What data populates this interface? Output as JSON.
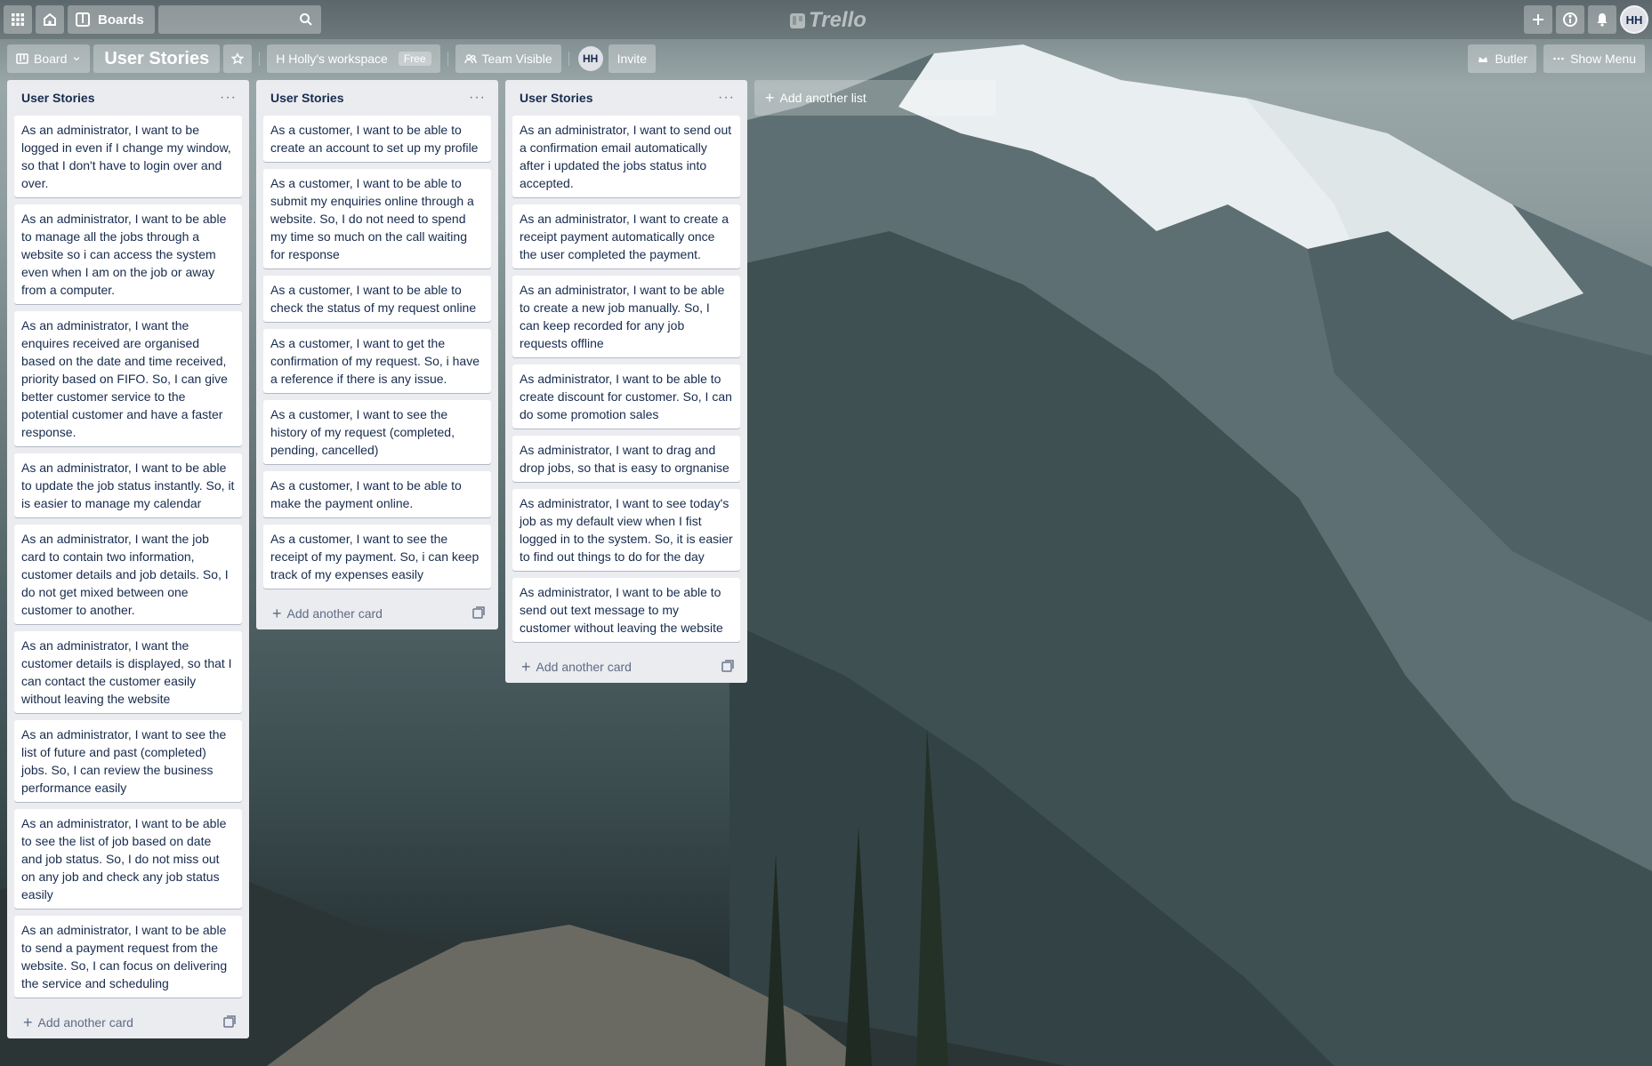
{
  "topbar": {
    "boards_label": "Boards",
    "logo_text": "Trello",
    "avatar_initials": "HH"
  },
  "board": {
    "view_label": "Board",
    "title": "User Stories",
    "workspace_label": "H Holly's workspace",
    "plan_badge": "Free",
    "visibility_label": "Team Visible",
    "member_initials": "HH",
    "invite_label": "Invite",
    "butler_label": "Butler",
    "show_menu_label": "Show Menu"
  },
  "add_list_label": "Add another list",
  "add_card_label": "Add another card",
  "lists": [
    {
      "title": "User Stories",
      "cards": [
        "As an administrator, I want to be logged in even if I change my window, so that I don't have to login over and over.",
        "As an administrator, I want to be able to manage all the jobs through a website so i can access the system even when I am on the job or away from a computer.",
        "As an administrator, I want the enquires received are organised based on the date and time received, priority based on FIFO. So, I can give better customer service to the potential customer and have a faster response.",
        "As an administrator, I want to be able to update the job status instantly. So, it is easier to manage my calendar",
        "As an administrator, I want the job card to contain two information, customer details and job details. So, I do not get mixed between one customer to another.",
        "As an administrator, I want the customer details is displayed, so that I can contact the customer easily without leaving the website",
        "As an administrator, I want to see the list of future and past (completed) jobs. So, I can review the business performance easily",
        "As an administrator, I want to be able to see the list of job based on date and job status. So, I do not miss out on any job and check any job status easily",
        "As an administrator, I want to be able to send a payment request from the website. So, I can focus on delivering the service and scheduling"
      ]
    },
    {
      "title": "User Stories",
      "cards": [
        "As a customer, I want to be able to create an account to set up my profile",
        "As a customer, I want to be able to submit my enquiries online through a website. So, I do not need to spend my time so much on the call waiting for response",
        "As a customer, I want to be able to check the status of my request online",
        "As a customer, I want to get the confirmation of my request. So, i have a reference if there is any issue.",
        "As a customer, I want to see the history of my request (completed, pending, cancelled)",
        "As a customer, I want to be able to make the payment online.",
        "As a customer, I want to see the receipt of my payment. So, i can keep track of my expenses easily"
      ]
    },
    {
      "title": "User Stories",
      "cards": [
        "As an administrator, I want to send out a confirmation email automatically after i updated the jobs status into accepted.",
        "As an administrator, I want to create a receipt payment automatically once the user completed the payment.",
        "As an administrator, I want to be able to create a new job manually. So, I can keep recorded for any job requests offline",
        "As administrator, I want to be able to create discount for customer. So, I can do some promotion sales",
        "As administrator, I want to drag and drop jobs, so that is easy to orgnanise",
        "As administrator, I want to see today's job as my default view when I fist logged in to the system. So, it is easier to find out things to do for the day",
        "As administrator, I want to be able to send out text message to my customer without leaving the website"
      ]
    }
  ]
}
